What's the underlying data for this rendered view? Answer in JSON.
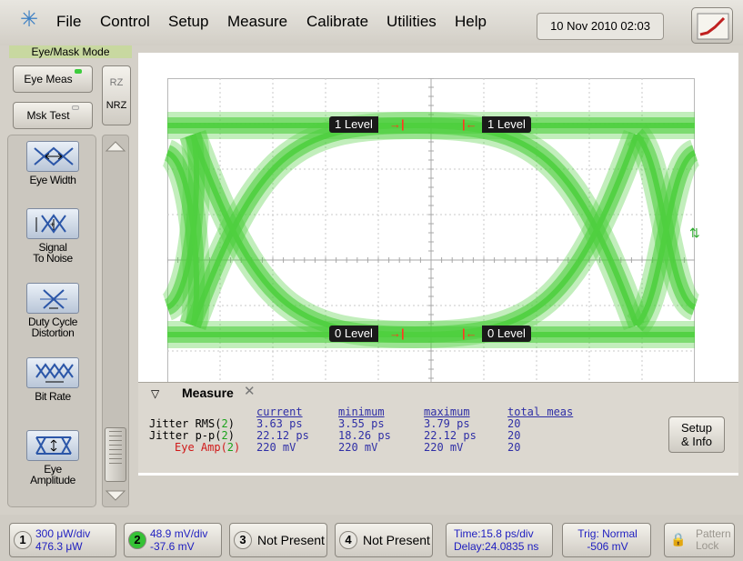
{
  "menu": {
    "file": "File",
    "control": "Control",
    "setup": "Setup",
    "measure": "Measure",
    "calibrate": "Calibrate",
    "utilities": "Utilities",
    "help": "Help"
  },
  "datetime": "10 Nov 2010  02:03",
  "mode_label": "Eye/Mask Mode",
  "left_panel": {
    "eye_meas": "Eye Meas",
    "msk_test": "Msk Test",
    "rz": "RZ",
    "nrz": "NRZ",
    "tools": [
      {
        "line1": "Eye Width",
        "line2": ""
      },
      {
        "line1": "Signal",
        "line2": "To Noise"
      },
      {
        "line1": "Duty Cycle",
        "line2": "Distortion"
      },
      {
        "line1": "Bit Rate",
        "line2": ""
      },
      {
        "line1": "Eye",
        "line2": "Amplitude"
      }
    ]
  },
  "display": {
    "level_tags": {
      "one_left": "1 Level",
      "one_right": "1 Level",
      "zero_left": "0 Level",
      "zero_right": "0 Level"
    },
    "trace_color": "#4fcf3f"
  },
  "measure": {
    "tab_label": "Measure",
    "headers": [
      "current",
      "minimum",
      "maximum",
      "total meas"
    ],
    "rows": [
      {
        "label": "Jitter RMS(",
        "source": "2",
        "label_end": ")",
        "current": "3.63 ps",
        "minimum": "3.55 ps",
        "maximum": "3.79 ps",
        "total": "20"
      },
      {
        "label": "Jitter p-p(",
        "source": "2",
        "label_end": ")",
        "current": "22.12 ps",
        "minimum": "18.26 ps",
        "maximum": "22.12 ps",
        "total": "20"
      },
      {
        "label": "Eye Amp(",
        "source": "2",
        "label_end": ")",
        "current": "220 mV",
        "minimum": "220 mV",
        "maximum": "220 mV",
        "total": "20"
      }
    ],
    "setup_info_line1": "Setup",
    "setup_info_line2": "& Info"
  },
  "bottom": {
    "ch1": {
      "num": "1",
      "line1": "300 μW/div",
      "line2": "476.3 μW"
    },
    "ch2": {
      "num": "2",
      "line1": "48.9 mV/div",
      "line2": "-37.6 mV"
    },
    "ch3": {
      "num": "3",
      "text": "Not Present"
    },
    "ch4": {
      "num": "4",
      "text": "Not Present"
    },
    "time": {
      "line1": "Time:15.8 ps/div",
      "line2": "Delay:24.0835 ns"
    },
    "trig": {
      "line1": "Trig: Normal",
      "line2": "-506 mV"
    },
    "lock": {
      "line1": "Pattern",
      "line2": "Lock"
    }
  }
}
